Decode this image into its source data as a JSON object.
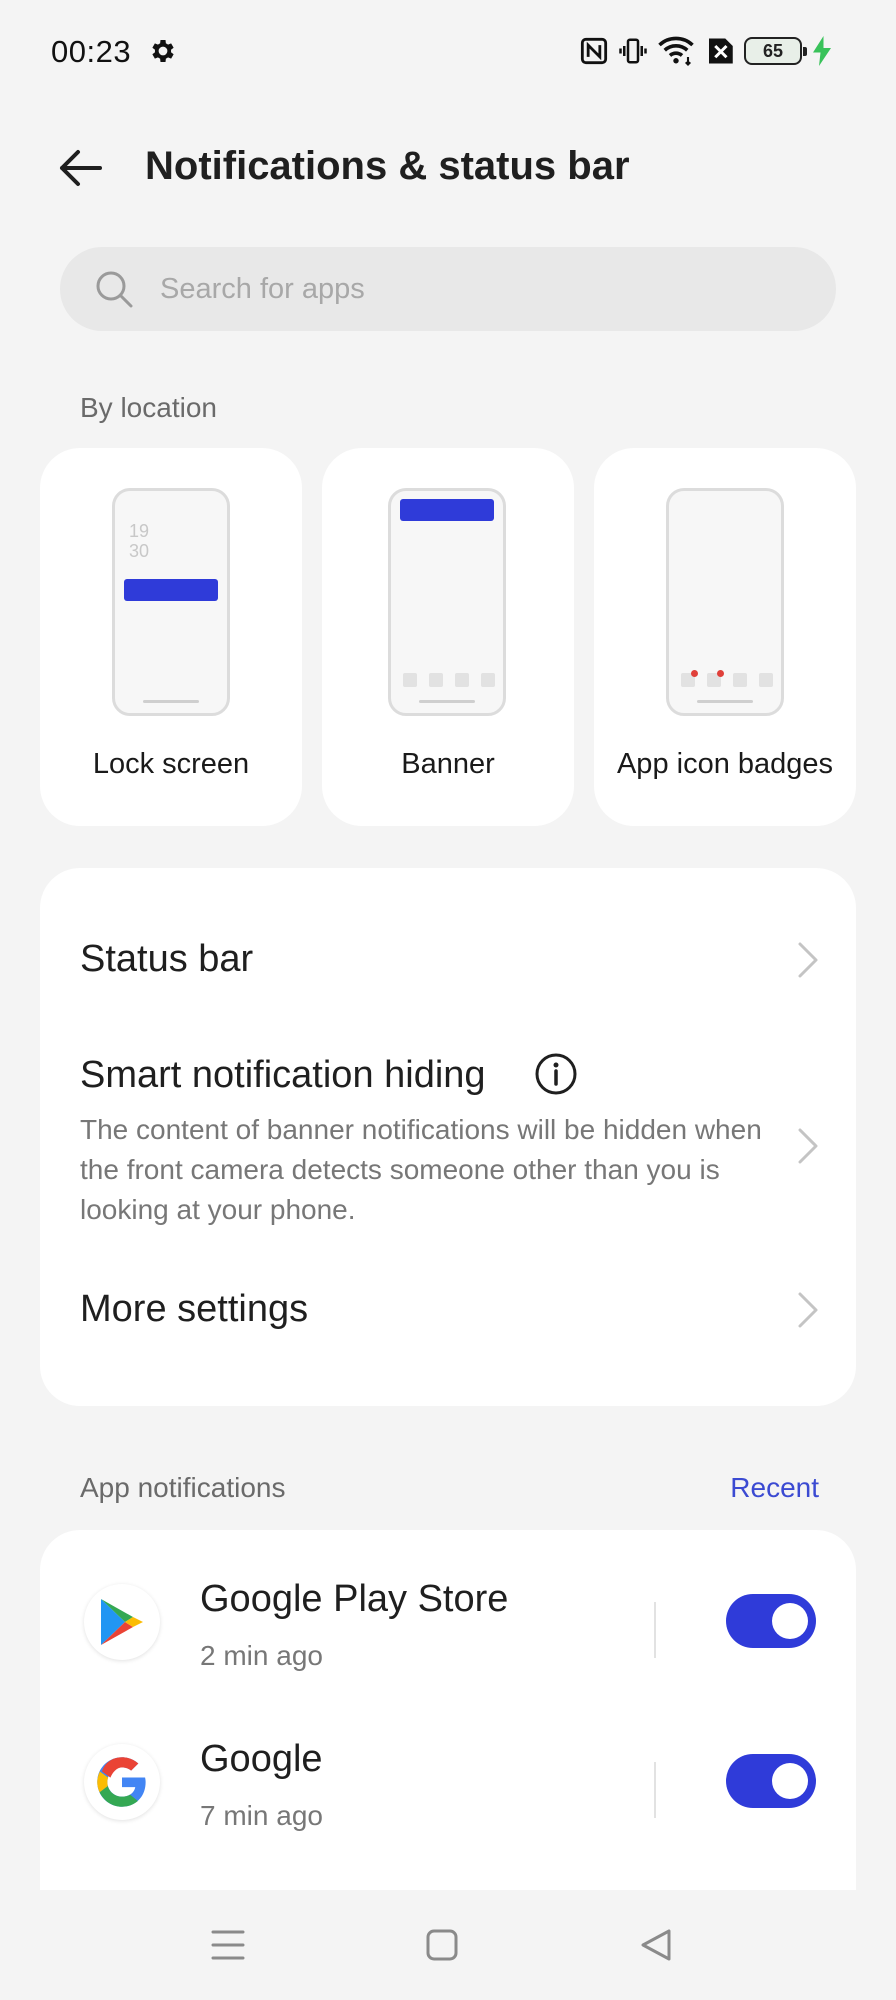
{
  "status_bar": {
    "time": "00:23",
    "battery_level": "65",
    "icons": [
      "gear-icon",
      "nfc-icon",
      "vibrate-icon",
      "wifi-icon",
      "sim-off-icon",
      "battery-icon",
      "charging-icon"
    ]
  },
  "header": {
    "title": "Notifications & status bar"
  },
  "search": {
    "placeholder": "Search for apps"
  },
  "by_location": {
    "label": "By location",
    "cards": [
      {
        "label": "Lock screen",
        "clock": [
          "19",
          "30"
        ]
      },
      {
        "label": "Banner"
      },
      {
        "label": "App icon badges"
      }
    ]
  },
  "settings": {
    "status_bar": {
      "title": "Status bar"
    },
    "smart_hiding": {
      "title": "Smart notification hiding",
      "description": "The content of banner notifications will be hidden when the front camera detects someone other than you is looking at your phone."
    },
    "more_settings": {
      "title": "More settings"
    }
  },
  "app_notifications": {
    "label": "App notifications",
    "sort_label": "Recent",
    "apps": [
      {
        "name": "Google Play Store",
        "time": "2 min ago",
        "enabled": true
      },
      {
        "name": "Google",
        "time": "7 min ago",
        "enabled": true
      }
    ]
  },
  "colors": {
    "accent": "#2f3bd9",
    "link": "#3b4ad2",
    "background": "#f4f4f4",
    "badge_dot": "#e0403a"
  }
}
